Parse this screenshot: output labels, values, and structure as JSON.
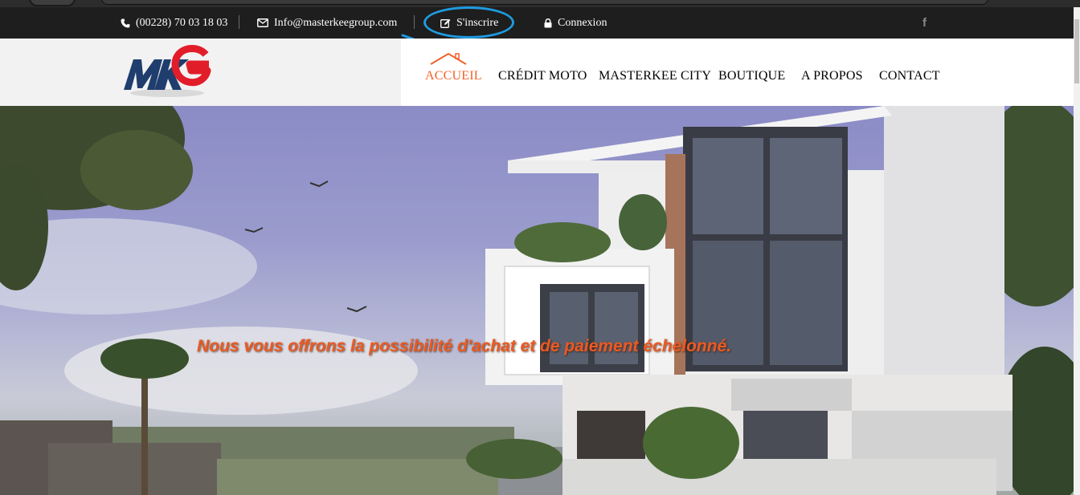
{
  "topbar": {
    "phone": "(00228) 70 03 18 03",
    "email": "Info@masterkeegroup.com",
    "signup": "S'inscrire",
    "login": "Connexion",
    "social_icon": "facebook-icon"
  },
  "header": {
    "logo_alt": "MKG",
    "nav": [
      {
        "label": "ACCUEIL",
        "active": true
      },
      {
        "label": "CRÉDIT MOTO",
        "active": false
      },
      {
        "label": "MASTERKEE CITY",
        "active": false
      },
      {
        "label": "BOUTIQUE",
        "active": false
      },
      {
        "label": "A PROPOS",
        "active": false
      },
      {
        "label": "CONTACT",
        "active": false
      }
    ]
  },
  "hero": {
    "tagline": "Nous vous offrons la possibilité d'achat et de paiement échelonné."
  },
  "colors": {
    "accent": "#f0622a",
    "topbar_bg": "#1e1e1e",
    "annotation": "#1e9be0"
  }
}
